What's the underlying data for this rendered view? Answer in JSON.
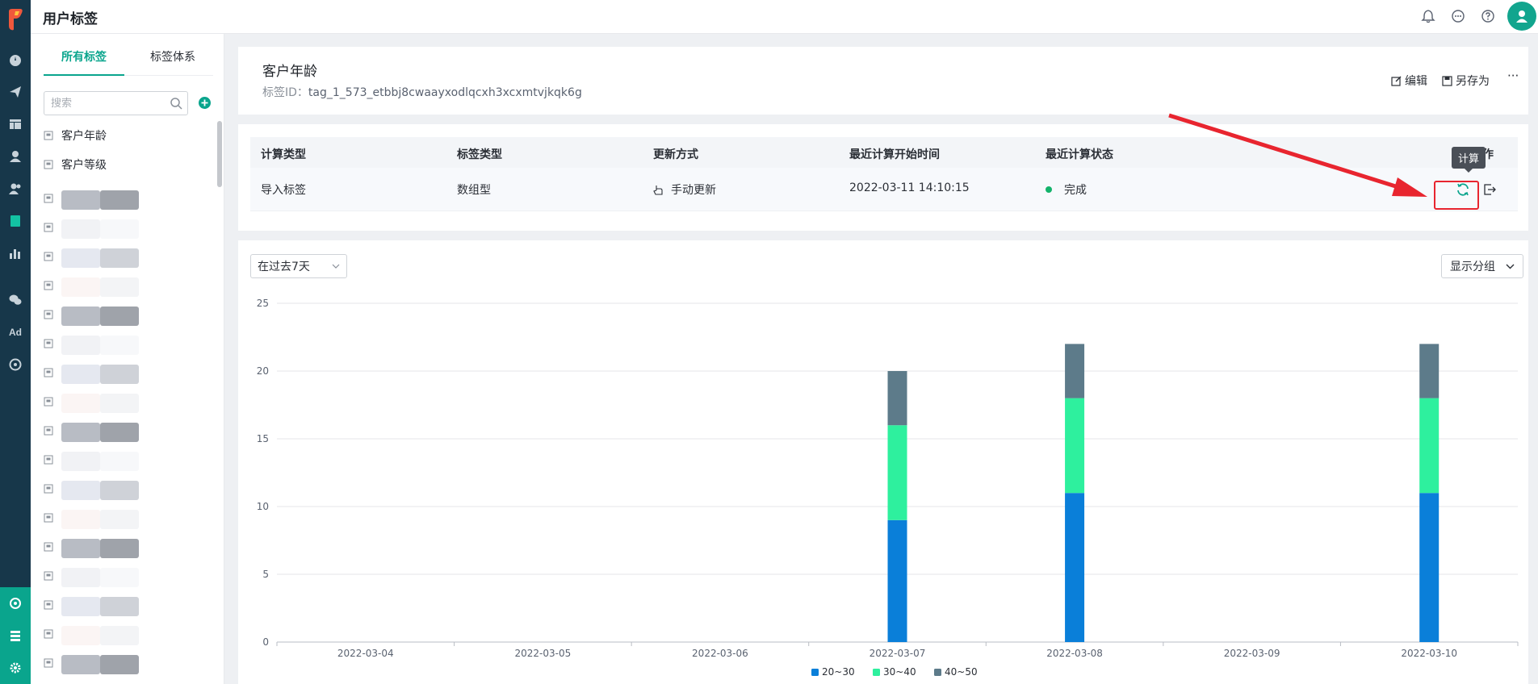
{
  "app": {
    "title": "用户标签"
  },
  "sidebar": {
    "tabs": [
      {
        "label": "所有标签",
        "active": true
      },
      {
        "label": "标签体系",
        "active": false
      }
    ],
    "search": {
      "placeholder": "搜索",
      "value": ""
    },
    "visible_tags": [
      "客户年龄",
      "客户等级"
    ]
  },
  "tag": {
    "name": "客户年龄",
    "id_label": "标签ID：",
    "id_value": "tag_1_573_etbbj8cwaayxodlqcxh3xcxmtvjkqk6g",
    "actions": {
      "edit": "编辑",
      "save_as": "另存为",
      "more": "···"
    }
  },
  "table": {
    "headers": {
      "calc_type": "计算类型",
      "tag_type": "标签类型",
      "update_method": "更新方式",
      "last_start": "最近计算开始时间",
      "last_status": "最近计算状态",
      "ops": "作"
    },
    "row": {
      "calc_type": "导入标签",
      "tag_type": "数组型",
      "update_method": "手动更新",
      "last_start": "2022-03-11 14:10:15",
      "last_status": "完成"
    },
    "tooltip": "计算"
  },
  "controls": {
    "range": "在过去7天",
    "group": "显示分组"
  },
  "colors": {
    "accent": "#0aa58d",
    "status_done": "#13b36b",
    "highlight": "#e8252f",
    "series_20_30": "#0a7fd9",
    "series_30_40": "#2ef09e",
    "series_40_50": "#5d7b8a"
  },
  "chart_data": {
    "type": "bar",
    "stacked": true,
    "categories": [
      "2022-03-04",
      "2022-03-05",
      "2022-03-06",
      "2022-03-07",
      "2022-03-08",
      "2022-03-09",
      "2022-03-10"
    ],
    "series": [
      {
        "name": "20~30",
        "color": "#0a7fd9",
        "values": [
          0,
          0,
          0,
          9,
          11,
          0,
          11
        ]
      },
      {
        "name": "30~40",
        "color": "#2ef09e",
        "values": [
          0,
          0,
          0,
          7,
          7,
          0,
          7
        ]
      },
      {
        "name": "40~50",
        "color": "#5d7b8a",
        "values": [
          0,
          0,
          0,
          4,
          4,
          0,
          4
        ]
      }
    ],
    "yticks": [
      0,
      5,
      10,
      15,
      20,
      25
    ],
    "ylim": [
      0,
      25
    ],
    "grid": true,
    "legend_position": "bottom-center"
  }
}
